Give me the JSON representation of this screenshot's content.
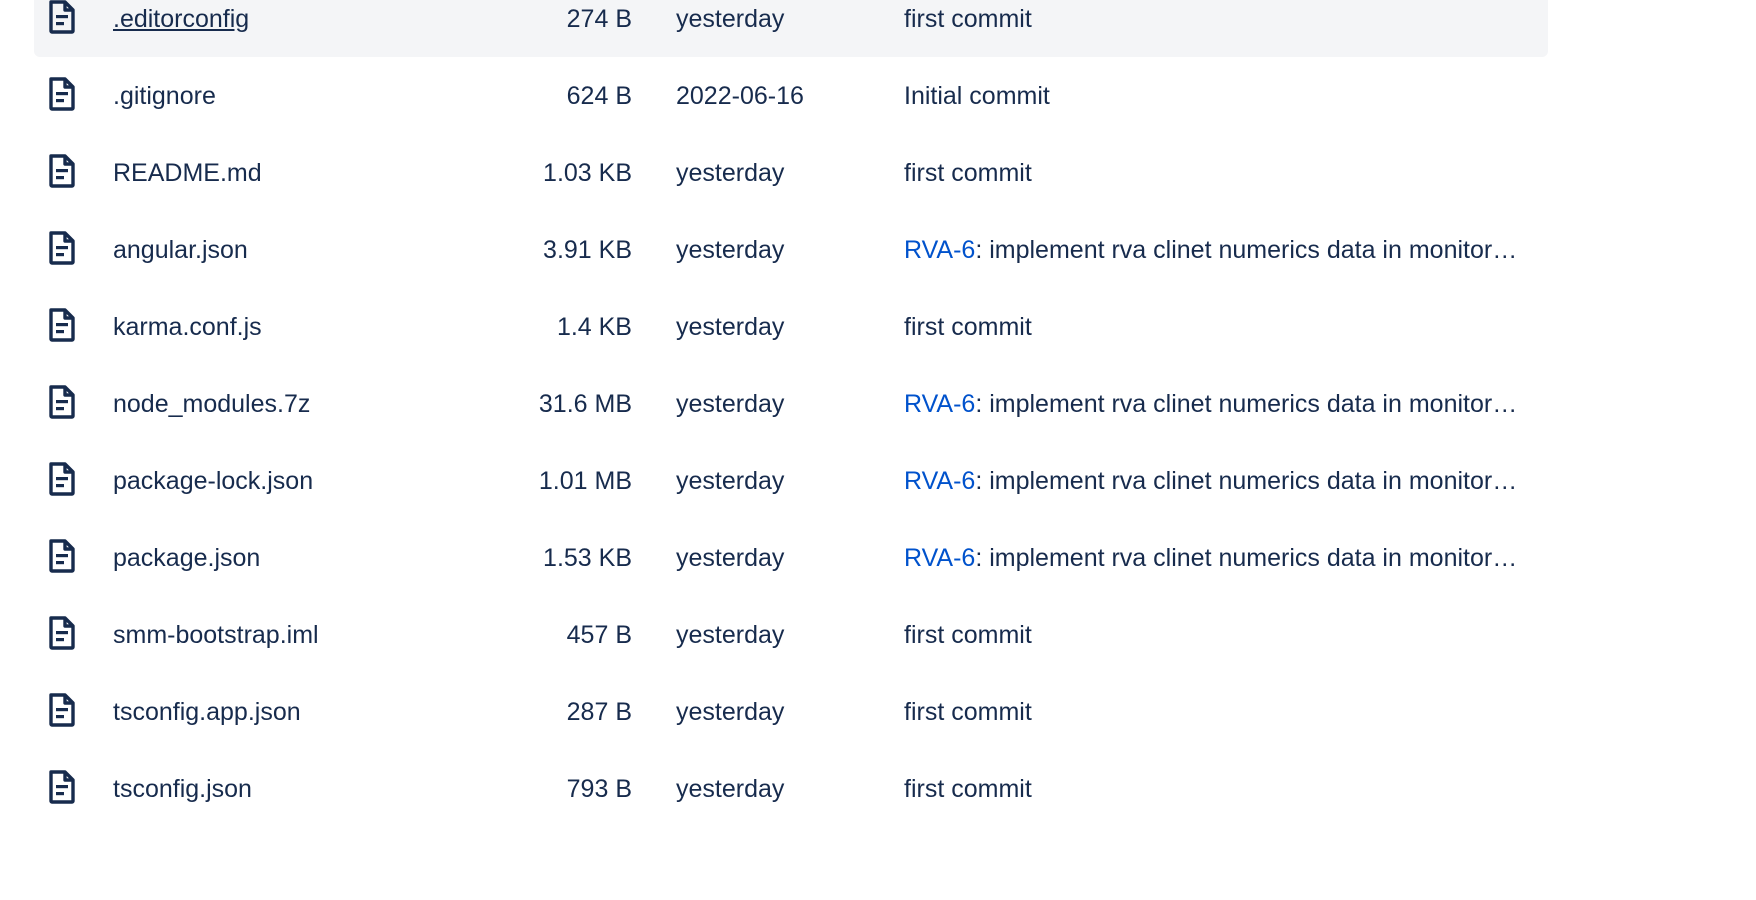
{
  "colors": {
    "text": "#172b4d",
    "link": "#0052cc",
    "hover_row_background": "#f4f5f7"
  },
  "file_list": {
    "rows": [
      {
        "icon": "file-icon",
        "name": ".editorconfig",
        "size": "274 B",
        "modified": "yesterday",
        "commit_issue": "",
        "commit_message": "first commit",
        "hovered": true
      },
      {
        "icon": "file-icon",
        "name": ".gitignore",
        "size": "624 B",
        "modified": "2022-06-16",
        "commit_issue": "",
        "commit_message": "Initial commit",
        "hovered": false
      },
      {
        "icon": "file-icon",
        "name": "README.md",
        "size": "1.03 KB",
        "modified": "yesterday",
        "commit_issue": "",
        "commit_message": "first commit",
        "hovered": false
      },
      {
        "icon": "file-icon",
        "name": "angular.json",
        "size": "3.91 KB",
        "modified": "yesterday",
        "commit_issue": "RVA-6",
        "commit_message": ": implement rva clinet numerics data in monitor…",
        "hovered": false
      },
      {
        "icon": "file-icon",
        "name": "karma.conf.js",
        "size": "1.4 KB",
        "modified": "yesterday",
        "commit_issue": "",
        "commit_message": "first commit",
        "hovered": false
      },
      {
        "icon": "file-icon",
        "name": "node_modules.7z",
        "size": "31.6 MB",
        "modified": "yesterday",
        "commit_issue": "RVA-6",
        "commit_message": ": implement rva clinet numerics data in monitor…",
        "hovered": false
      },
      {
        "icon": "file-icon",
        "name": "package-lock.json",
        "size": "1.01 MB",
        "modified": "yesterday",
        "commit_issue": "RVA-6",
        "commit_message": ": implement rva clinet numerics data in monitor…",
        "hovered": false
      },
      {
        "icon": "file-icon",
        "name": "package.json",
        "size": "1.53 KB",
        "modified": "yesterday",
        "commit_issue": "RVA-6",
        "commit_message": ": implement rva clinet numerics data in monitor…",
        "hovered": false
      },
      {
        "icon": "file-icon",
        "name": "smm-bootstrap.iml",
        "size": "457 B",
        "modified": "yesterday",
        "commit_issue": "",
        "commit_message": "first commit",
        "hovered": false
      },
      {
        "icon": "file-icon",
        "name": "tsconfig.app.json",
        "size": "287 B",
        "modified": "yesterday",
        "commit_issue": "",
        "commit_message": "first commit",
        "hovered": false
      },
      {
        "icon": "file-icon",
        "name": "tsconfig.json",
        "size": "793 B",
        "modified": "yesterday",
        "commit_issue": "",
        "commit_message": "first commit",
        "hovered": false
      }
    ]
  }
}
